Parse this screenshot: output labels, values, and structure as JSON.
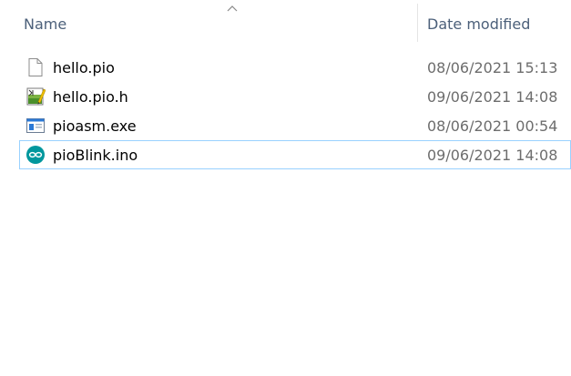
{
  "columns": {
    "name_label": "Name",
    "date_label": "Date modified",
    "sort_direction": "ascending"
  },
  "files": [
    {
      "name": "hello.pio",
      "date": "08/06/2021 15:13",
      "icon": "blank-file-icon"
    },
    {
      "name": "hello.pio.h",
      "date": "09/06/2021 14:08",
      "icon": "header-file-icon"
    },
    {
      "name": "pioasm.exe",
      "date": "08/06/2021 00:54",
      "icon": "executable-icon"
    },
    {
      "name": "pioBlink.ino",
      "date": "09/06/2021 14:08",
      "icon": "arduino-icon"
    }
  ],
  "colors": {
    "header_text": "#4c607a",
    "date_text": "#6d6d6d",
    "focus_border": "#99d1ff",
    "arduino_teal": "#00979d"
  }
}
